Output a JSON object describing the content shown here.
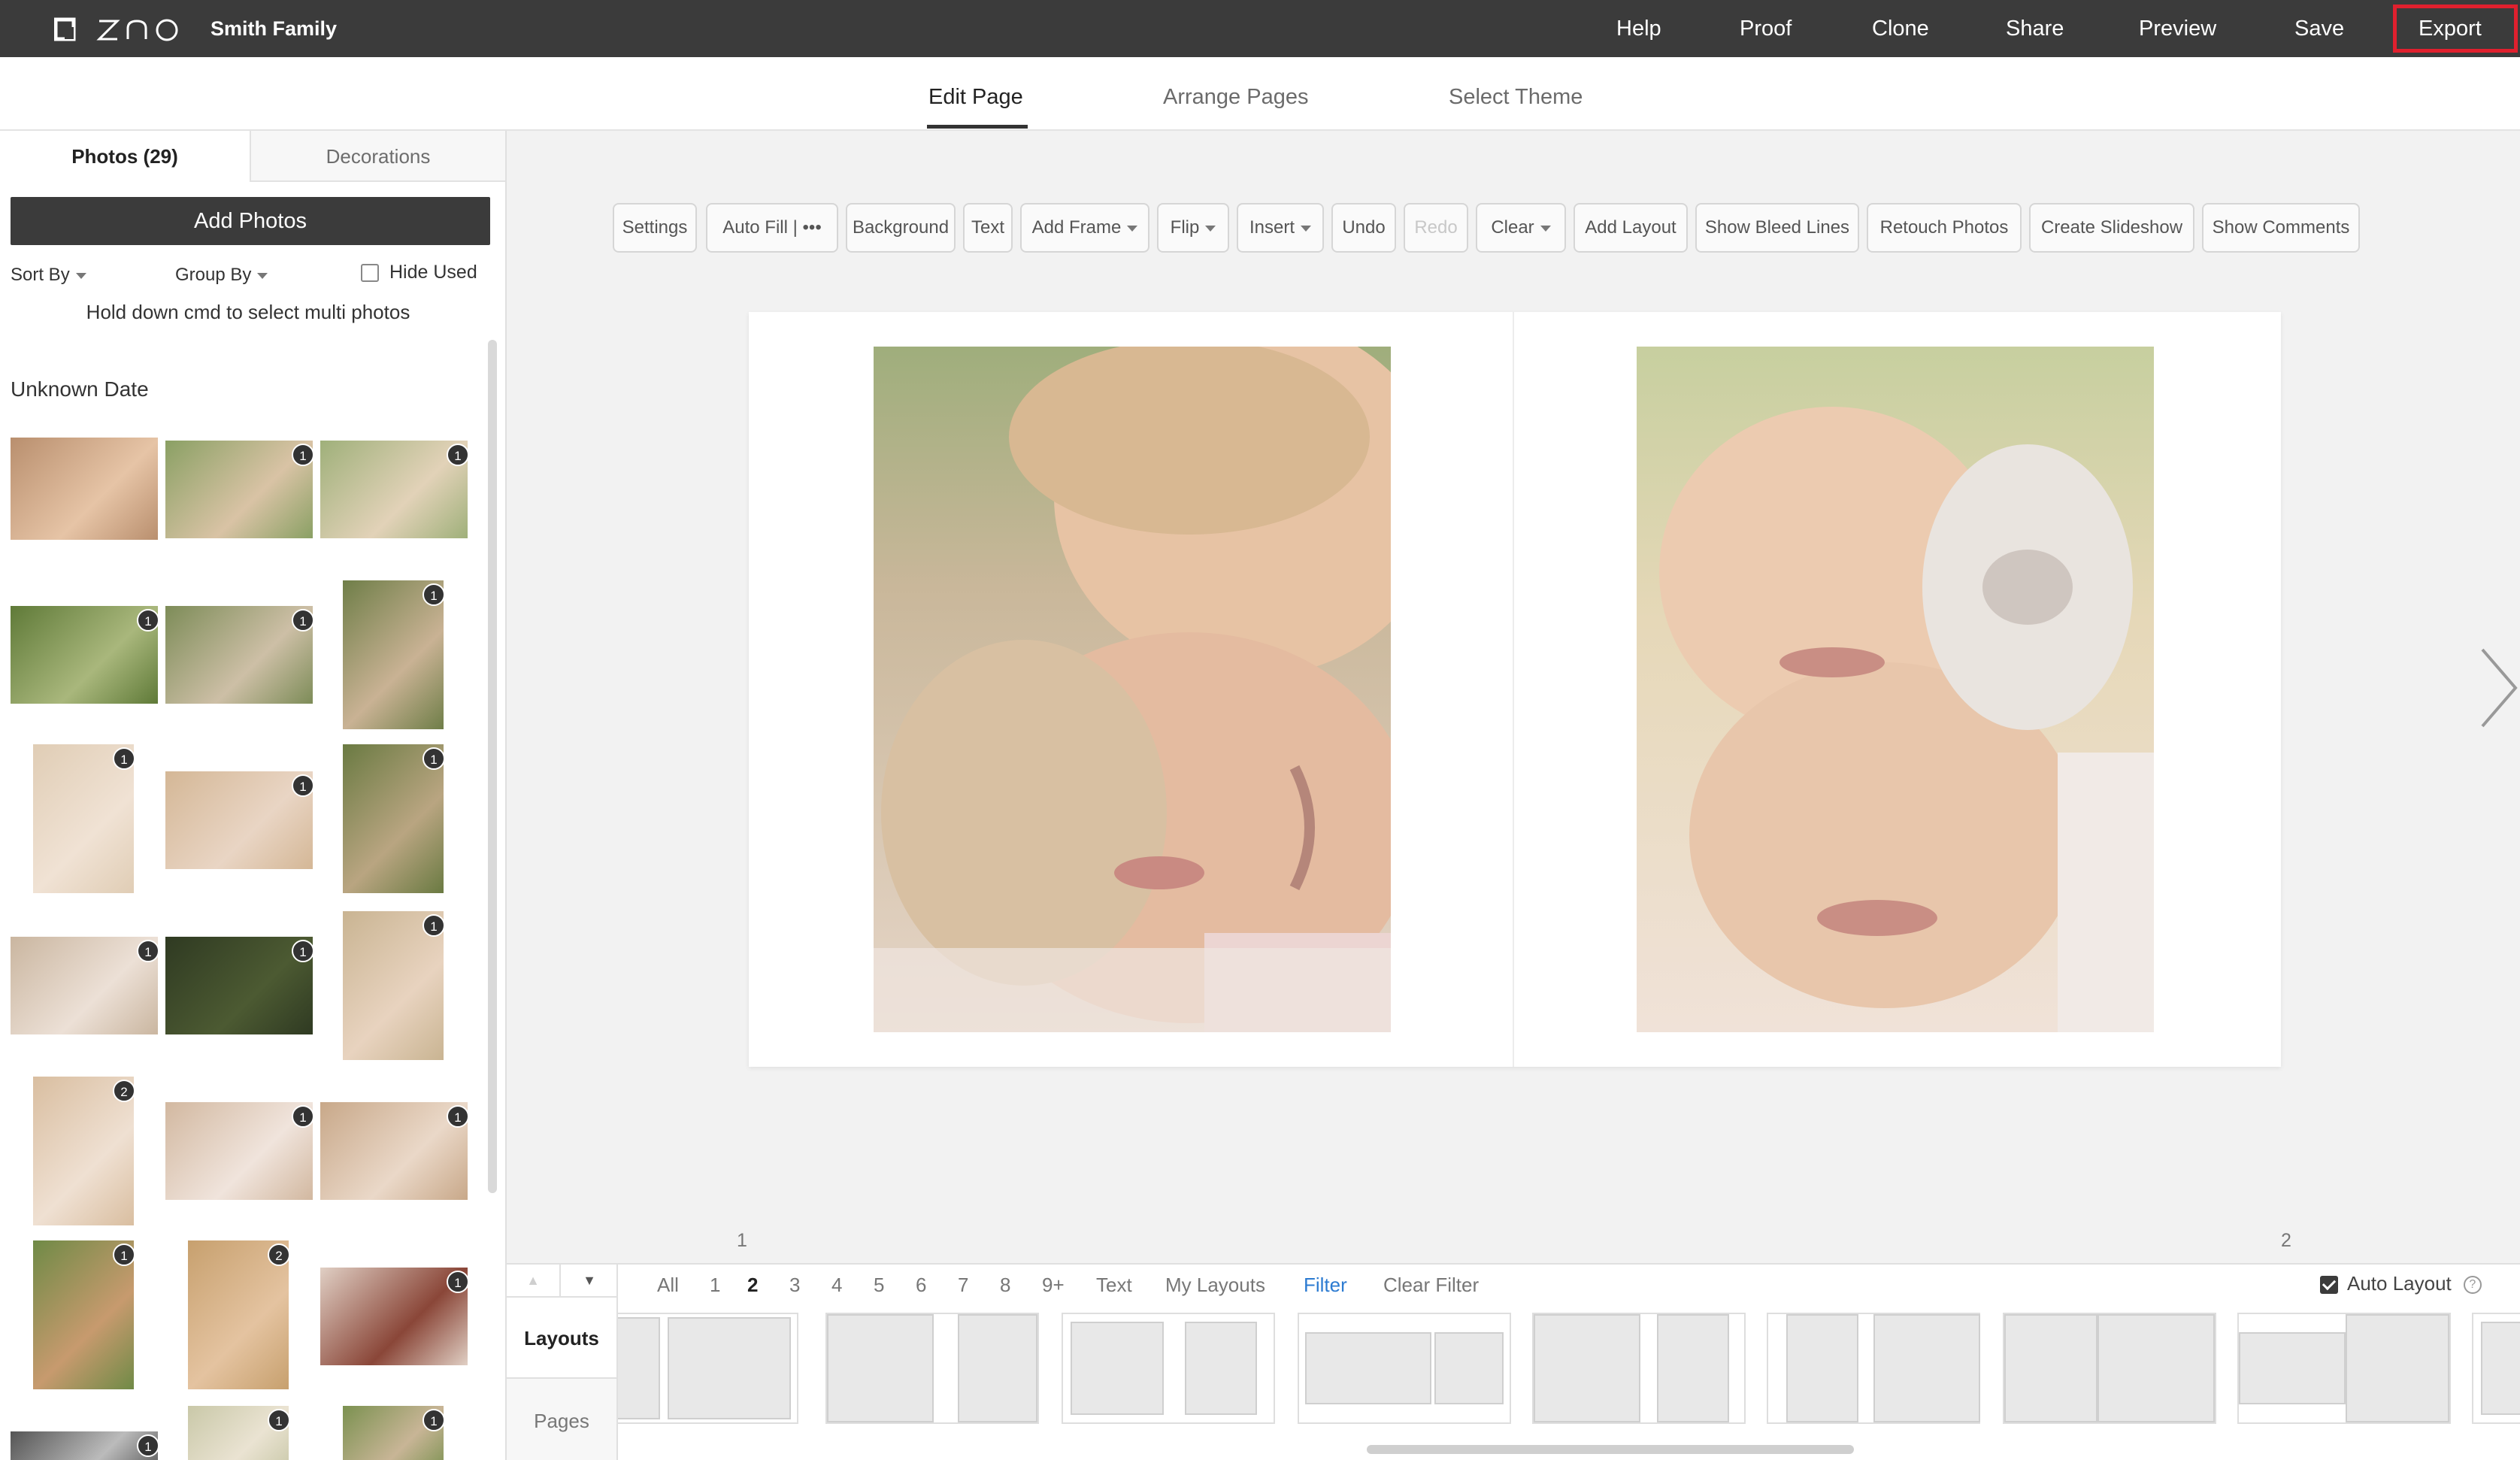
{
  "header": {
    "logo_text": "ZNO",
    "project_name": "Smith Family",
    "nav": [
      "Help",
      "Proof",
      "Clone",
      "Share",
      "Preview",
      "Save",
      "Export"
    ]
  },
  "subtabs": [
    "Edit Page",
    "Arrange Pages",
    "Select Theme"
  ],
  "left_panel": {
    "tabs": [
      "Photos (29)",
      "Decorations"
    ],
    "add_photos": "Add Photos",
    "sort_by": "Sort By",
    "group_by": "Group By",
    "hide_used": "Hide Used",
    "hint": "Hold down cmd to select multi photos",
    "date_group": "Unknown Date",
    "badges": [
      "1",
      "1",
      "1",
      "1",
      "1",
      "1",
      "1",
      "1",
      "1",
      "1",
      "1",
      "2",
      "1",
      "1",
      "1",
      "2",
      "1",
      "1",
      "1",
      "1"
    ]
  },
  "toolbar": {
    "buttons": [
      "Settings",
      "Auto Fill",
      "Background",
      "Text",
      "Add Frame",
      "Flip",
      "Insert",
      "Undo",
      "Redo",
      "Clear",
      "Add Layout",
      "Show Bleed Lines",
      "Retouch Photos",
      "Create Slideshow",
      "Show Comments"
    ],
    "autofill_more": "| •••"
  },
  "pages": {
    "left": "1",
    "right": "2"
  },
  "bottom": {
    "filters": [
      "All",
      "1",
      "2",
      "3",
      "4",
      "5",
      "6",
      "7",
      "8",
      "9+",
      "Text",
      "My Layouts",
      "Filter",
      "Clear Filter"
    ],
    "auto_layout": "Auto Layout",
    "help_icon": "?",
    "side_tabs": [
      "Layouts",
      "Pages"
    ],
    "up_arrow": "▲",
    "down_arrow": "▼"
  },
  "colors": {
    "accent_blue": "#2c7bd1",
    "export_highlight": "#e0202e",
    "topbar": "#3b3b3b"
  }
}
